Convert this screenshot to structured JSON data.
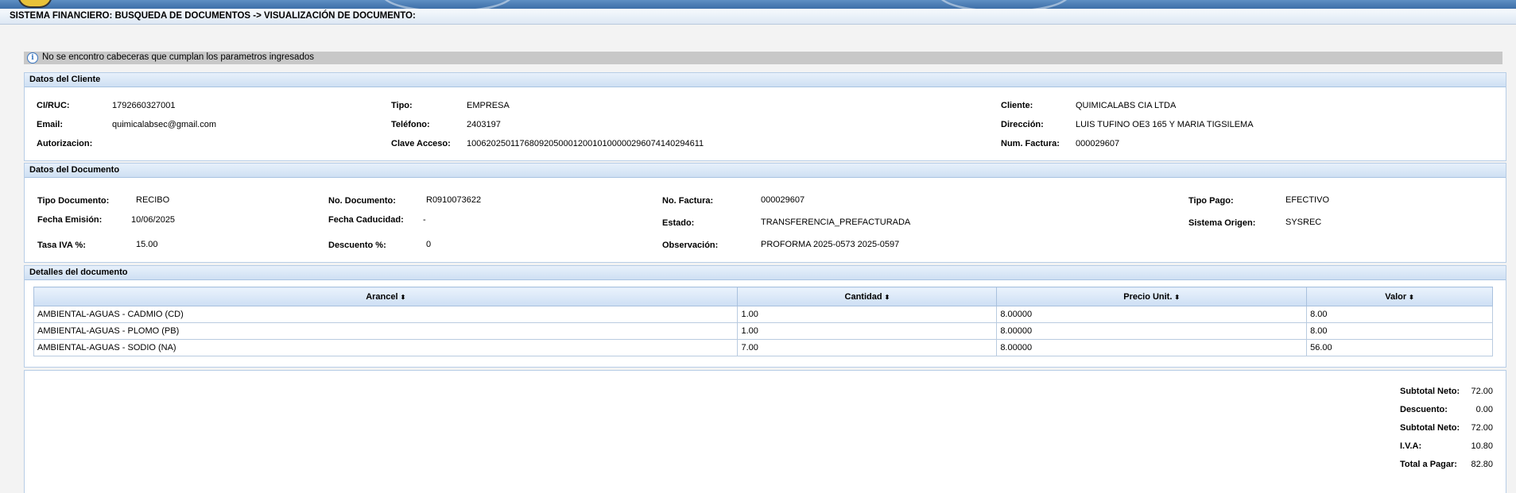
{
  "header": {
    "title": "SISTEMA FINANCIERO: BUSQUEDA DE DOCUMENTOS -> VISUALIZACIÓN DE DOCUMENTO:"
  },
  "message": {
    "icon": "info-icon",
    "text": "No se encontro cabeceras que cumplan los parametros ingresados"
  },
  "cliente": {
    "title": "Datos del Cliente",
    "ci_label": "CI/RUC:",
    "ci_value": "1792660327001",
    "email_label": "Email:",
    "email_value": "quimicalabsec@gmail.com",
    "autorizacion_label": "Autorizacion:",
    "tipo_label": "Tipo:",
    "tipo_value": "EMPRESA",
    "telefono_label": "Teléfono:",
    "telefono_value": "2403197",
    "clave_label": "Clave Acceso:",
    "clave_value": "1006202501176809205000120010100000296074140294611",
    "cliente_label": "Cliente:",
    "cliente_value": "QUIMICALABS CIA LTDA",
    "direccion_label": "Dirección:",
    "direccion_value": "LUIS TUFINO OE3 165 Y MARIA TIGSILEMA",
    "numfact_label": "Num. Factura:",
    "numfact_value": "000029607"
  },
  "documento": {
    "title": "Datos del Documento",
    "tipo_doc_label": "Tipo Documento:",
    "tipo_doc_value": "RECIBO",
    "fecha_em_label": "Fecha Emisión:",
    "fecha_em_value": "10/06/2025",
    "tasa_iva_label": "Tasa IVA %:",
    "tasa_iva_value": "15.00",
    "nodoc_label": "No. Documento:",
    "nodoc_value": "R0910073622",
    "fecha_cad_label": "Fecha Caducidad:",
    "fecha_cad_value": "-",
    "descuento_label": "Descuento %:",
    "descuento_value": "0",
    "nofact_label": "No. Factura:",
    "nofact_value": "000029607",
    "estado_label": "Estado:",
    "estado_value": "TRANSFERENCIA_PREFACTURADA",
    "obs_label": "Observación:",
    "obs_value": "PROFORMA 2025-0573 2025-0597",
    "tipo_pago_label": "Tipo Pago:",
    "tipo_pago_value": "EFECTIVO",
    "sistema_label": "Sistema Origen:",
    "sistema_value": "SYSREC"
  },
  "detalles": {
    "title": "Detalles del documento",
    "columns": [
      "Arancel",
      "Cantidad",
      "Precio Unit.",
      "Valor"
    ],
    "sort_icon": "sort-icon",
    "rows": [
      [
        "AMBIENTAL-AGUAS - CADMIO (CD)",
        "1.00",
        "8.00000",
        "8.00"
      ],
      [
        "AMBIENTAL-AGUAS - PLOMO (PB)",
        "1.00",
        "8.00000",
        "8.00"
      ],
      [
        "AMBIENTAL-AGUAS - SODIO (NA)",
        "7.00",
        "8.00000",
        "56.00"
      ]
    ]
  },
  "totales": [
    {
      "label": "Subtotal Neto:",
      "value": "72.00"
    },
    {
      "label": "Descuento:",
      "value": "0.00"
    },
    {
      "label": "Subtotal Neto:",
      "value": "72.00"
    },
    {
      "label": "I.V.A:",
      "value": "10.80"
    },
    {
      "label": "Total a Pagar:",
      "value": "82.80"
    }
  ]
}
